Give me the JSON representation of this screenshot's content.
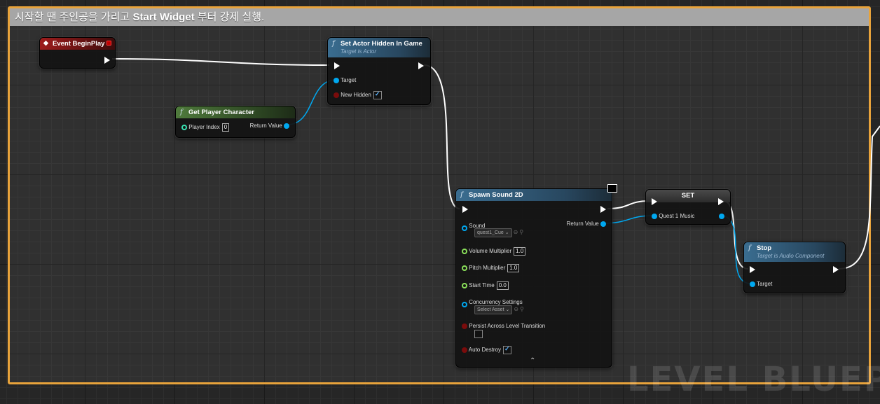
{
  "comment": {
    "prefix": "시작할 땐 주인공을 가리고 ",
    "bold": "Start Widget",
    "suffix": " 부터 강제 실행."
  },
  "watermark": "LEVEL BLUEPR",
  "nodes": {
    "begin_play": {
      "title": "Event BeginPlay"
    },
    "set_hidden": {
      "title": "Set Actor Hidden In Game",
      "subtitle": "Target is Actor",
      "target": "Target",
      "new_hidden": "New Hidden",
      "new_hidden_checked": true
    },
    "get_player": {
      "title": "Get Player Character",
      "player_index": "Player Index",
      "player_index_value": "0",
      "return_value": "Return Value"
    },
    "spawn_sound": {
      "title": "Spawn Sound 2D",
      "sound": "Sound",
      "sound_value": "quest1_Cue",
      "return_value": "Return Value",
      "volume": "Volume Multiplier",
      "volume_value": "1.0",
      "pitch": "Pitch Multiplier",
      "pitch_value": "1.0",
      "start_time": "Start Time",
      "start_time_value": "0.0",
      "concurrency": "Concurrency Settings",
      "concurrency_value": "Select Asset",
      "persist": "Persist Across Level Transition",
      "persist_checked": false,
      "auto_destroy": "Auto Destroy",
      "auto_destroy_checked": true,
      "collapse": "⌃"
    },
    "set_var": {
      "title": "SET",
      "var_name": "Quest 1 Music"
    },
    "stop": {
      "title": "Stop",
      "subtitle": "Target is Audio Component",
      "target": "Target"
    }
  },
  "colors": {
    "comment_border": "#e8a33b",
    "exec_wire": "#ffffff",
    "object_wire": "#00a8f0"
  },
  "icons": [
    "function-icon",
    "event-diamond-icon",
    "monitor-icon",
    "browse-icon",
    "search-icon",
    "checkmark-icon"
  ]
}
